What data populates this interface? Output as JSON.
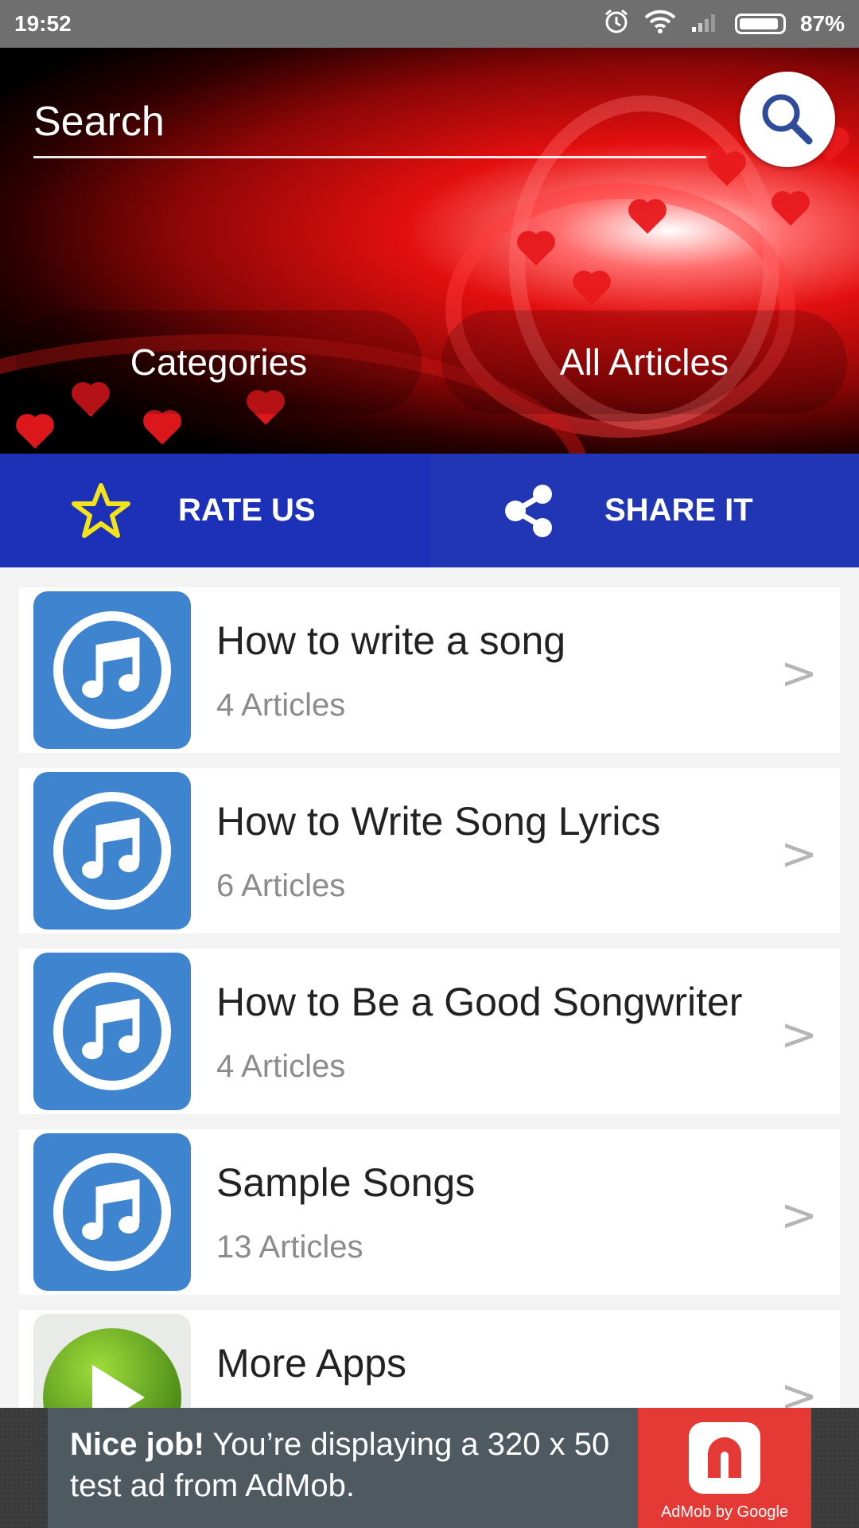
{
  "status_bar": {
    "time": "19:52",
    "battery": "87%",
    "icons": [
      "alarm-icon",
      "wifi-icon",
      "signal-icon",
      "battery-icon"
    ]
  },
  "search": {
    "placeholder": "Search"
  },
  "hero_tabs": [
    {
      "label": "Categories"
    },
    {
      "label": "All Articles"
    }
  ],
  "actions": {
    "rate_label": "RATE US",
    "share_label": "SHARE IT"
  },
  "list": [
    {
      "title": "How to write a song",
      "subtitle": "4 Articles",
      "icon": "music-note-icon"
    },
    {
      "title": "How to Write Song Lyrics",
      "subtitle": "6 Articles",
      "icon": "music-note-icon"
    },
    {
      "title": "How to Be a Good Songwriter",
      "subtitle": "4 Articles",
      "icon": "music-note-icon"
    },
    {
      "title": "Sample Songs",
      "subtitle": "13 Articles",
      "icon": "music-note-icon"
    },
    {
      "title": "More Apps",
      "subtitle": "",
      "icon": "play-icon"
    }
  ],
  "ad": {
    "headline": "Nice job!",
    "body": " You’re displaying a 320 x 50 test ad from AdMob.",
    "brand": "AdMob by Google"
  },
  "colors": {
    "status_bar": "#6f6f6f",
    "action_bar": "#1c30b8",
    "thumb_blue": "#3f84cf",
    "ad_red": "#e53935"
  }
}
